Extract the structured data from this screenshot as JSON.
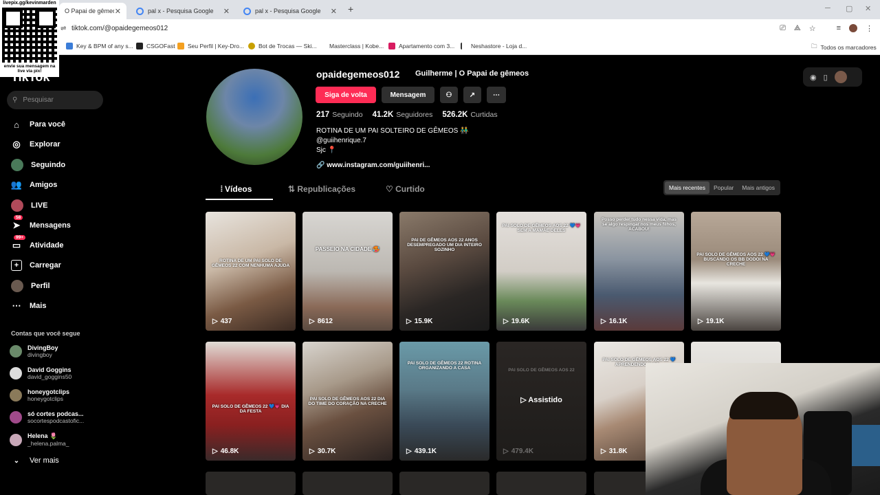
{
  "browser": {
    "tabs": [
      {
        "label": "O Papai de gêmeos"
      },
      {
        "label": "pal x - Pesquisa Google"
      },
      {
        "label": "pal x - Pesquisa Google"
      }
    ],
    "url": "tiktok.com/@opaidegemeos012",
    "bookmarks": [
      "Key & BPM of any s...",
      "CSGOFast",
      "Seu Perfil | Key-Dro...",
      "Bot de Trocas — Ski...",
      "Masterclass | Kobe...",
      "Apartamento com 3...",
      "Neshastore - Loja d...",
      "Todos os marcadores"
    ]
  },
  "overlay": {
    "url": "livepix.gg/kevinmarden",
    "text": "envie sua mensagem na live via pix!"
  },
  "sidebar": {
    "logo": "TikTok",
    "search_placeholder": "Pesquisar",
    "nav": [
      {
        "label": "Para você",
        "icon": "home-icon"
      },
      {
        "label": "Explorar",
        "icon": "compass-icon"
      },
      {
        "label": "Seguindo",
        "icon": "following-avatar-icon"
      },
      {
        "label": "Amigos",
        "icon": "friends-icon"
      },
      {
        "label": "LIVE",
        "icon": "live-icon"
      },
      {
        "label": "Mensagens",
        "icon": "messages-icon",
        "badge": "58"
      },
      {
        "label": "Atividade",
        "icon": "activity-icon",
        "badge": "99+"
      },
      {
        "label": "Carregar",
        "icon": "upload-icon"
      },
      {
        "label": "Perfil",
        "icon": "profile-icon"
      },
      {
        "label": "Mais",
        "icon": "more-icon"
      }
    ],
    "following_header": "Contas que você segue",
    "following": [
      {
        "name": "DivingBoy",
        "handle": "divingboy"
      },
      {
        "name": "David Goggins",
        "handle": "david_goggins50"
      },
      {
        "name": "honeygotclips",
        "handle": "honeygotclips"
      },
      {
        "name": "só cortes podcas...",
        "handle": "socortespodcastofic..."
      },
      {
        "name": "Helena 🌷",
        "handle": "_helena.palma_"
      }
    ],
    "see_more": "Ver mais"
  },
  "profile": {
    "username": "opaidegemeos012",
    "display_name": "Guilherme | O Papai de gêmeos",
    "follow_back": "Siga de volta",
    "message": "Mensagem",
    "following_count": "217",
    "following_label": "Seguindo",
    "followers_count": "41.2K",
    "followers_label": "Seguidores",
    "likes_count": "526.2K",
    "likes_label": "Curtidas",
    "bio_line1": "ROTINA DE UM PAI SOLTEIRO DE GÊMEOS 👬",
    "bio_line2": "@guiihenrique.7",
    "bio_line3": "Sjc 📍",
    "link": "www.instagram.com/guiihenri..."
  },
  "content_tabs": {
    "videos": "Vídeos",
    "reposts": "Republicações",
    "liked": "Curtido",
    "sort_recent": "Mais recentes",
    "sort_popular": "Popular",
    "sort_oldest": "Mais antigos"
  },
  "videos": [
    {
      "views": "437",
      "caption": "ROTINA DE UM PAI SOLO DE GÊMEOS 22 COM NENHUMA AJUDA"
    },
    {
      "views": "8612",
      "caption": "PASSEIO NA CIDADE 🥵"
    },
    {
      "views": "15.9K",
      "caption": "PAI DE GÊMEOS AOS 22 ANOS DESEMPREGADO UM DIA INTEIRO SOZINHO"
    },
    {
      "views": "19.6K",
      "caption": "PAI SOLO DE GÊMEOS AOS 22 💙💗 SEM A MAMÃE DELES"
    },
    {
      "views": "16.1K",
      "caption": "Posso perder tudo nessa vida, mas se algo respingar nos meus filhos, ACABOU!"
    },
    {
      "views": "19.1K",
      "caption": "PAI SOLO DE GÊMEOS AOS 22 💙💗 BUSCANDO OS BB DODOI NA CRECHE"
    },
    {
      "views": "46.8K",
      "caption": "PAI SOLO DE GÊMEOS 22 💙💗 DIA DA FESTA"
    },
    {
      "views": "30.7K",
      "caption": "PAI SOLO DE GÊMEOS AOS 22 DIA DO TIME DO CORAÇÃO NA CRECHE"
    },
    {
      "views": "439.1K",
      "caption": "PAI SOLO DE GÊMEOS 22 ROTINA ORGANIZANDO A CASA"
    },
    {
      "views": "479.4K",
      "caption": "PAI SOLO DE GÊMEOS AOS 22",
      "watched": "Assistido"
    },
    {
      "views": "31.8K",
      "caption": "PAI SOLO DE GÊMEOS AOS 22 💙 APRENDENDO A CO..."
    },
    {
      "views": "",
      "caption": ""
    }
  ]
}
